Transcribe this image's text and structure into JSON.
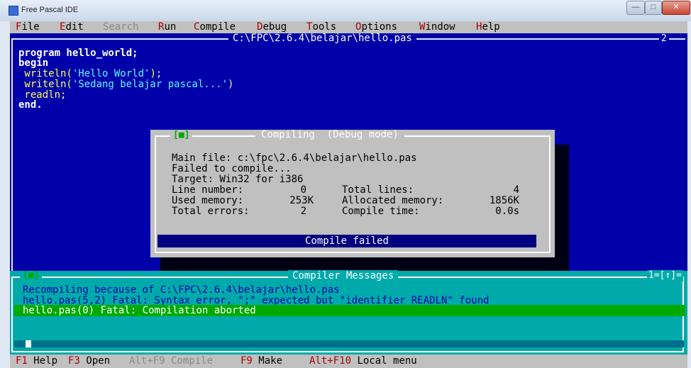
{
  "window": {
    "title": "Free Pascal IDE",
    "buttons": {
      "minimize": "—",
      "maximize": "□",
      "close": "✕"
    }
  },
  "menu": [
    {
      "hotkey": "F",
      "rest": "ile",
      "enabled": true
    },
    {
      "hotkey": "E",
      "rest": "dit",
      "enabled": true
    },
    {
      "hotkey": "",
      "rest": "Search",
      "enabled": false
    },
    {
      "hotkey": "R",
      "rest": "un",
      "enabled": true
    },
    {
      "hotkey": "C",
      "rest": "ompile",
      "enabled": true
    },
    {
      "hotkey": "D",
      "rest": "ebug",
      "enabled": true
    },
    {
      "hotkey": "T",
      "rest": "ools",
      "enabled": true
    },
    {
      "hotkey": "O",
      "rest": "ptions",
      "enabled": true
    },
    {
      "hotkey": "W",
      "rest": "indow",
      "enabled": true
    },
    {
      "hotkey": "H",
      "rest": "elp",
      "enabled": true
    }
  ],
  "editor": {
    "title": "C:\\FPC\\2.6.4\\belajar\\hello.pas",
    "window_number": "2",
    "code": [
      {
        "text": "program hello_world;"
      },
      {
        "text": "begin"
      },
      {
        "pre": " writeln(",
        "str": "'Hello World'",
        "post": ");"
      },
      {
        "pre": " writeln(",
        "str": "'Sedang belajar pascal...'",
        "post": ")"
      },
      {
        "text": " readln;"
      },
      {
        "text": "end."
      }
    ]
  },
  "dialog": {
    "close_glyph": "[■]",
    "title": "Compiling  (Debug mode)",
    "main_file": "Main file: c:\\fpc\\2.6.4\\belajar\\hello.pas",
    "status_line": "Failed to compile...",
    "target": "Target: Win32 for i386",
    "stats": {
      "line_number_label": "Line number:",
      "line_number": "0",
      "total_lines_label": "Total lines:",
      "total_lines": "4",
      "used_memory_label": "Used memory:",
      "used_memory": "253K",
      "allocated_memory_label": "Allocated memory:",
      "allocated_memory": "1856K",
      "total_errors_label": "Total errors:",
      "total_errors": "2",
      "compile_time_label": "Compile time:",
      "compile_time": "0.0s"
    },
    "result": "Compile failed"
  },
  "messages": {
    "close_glyph": "[■]",
    "title": "Compiler Messages",
    "window_number": "1=[↑]=",
    "lines": [
      "Recompiling because of C:\\FPC\\2.6.4\\belajar\\hello.pas",
      "hello.pas(5,2) Fatal: Syntax error, \";\" expected but \"identifier READLN\" found",
      "hello.pas(0) Fatal: Compilation aborted"
    ],
    "selected_index": 2
  },
  "statusbar": [
    {
      "key": "F1",
      "label": " Help",
      "enabled": true
    },
    {
      "key": "F3",
      "label": " Open",
      "enabled": true
    },
    {
      "key": "Alt+F9",
      "label": " Compile",
      "enabled": false
    },
    {
      "key": "F9",
      "label": " Make",
      "enabled": true
    },
    {
      "key": "Alt+F10",
      "label": " Local menu",
      "enabled": true
    }
  ],
  "colors": {
    "editor_bg": "#0000aa",
    "menu_bg": "#c0c0c0",
    "messages_bg": "#00aaaa",
    "selected_msg": "#00aa00",
    "hotkey": "#aa0000",
    "result_bar": "#000080"
  }
}
